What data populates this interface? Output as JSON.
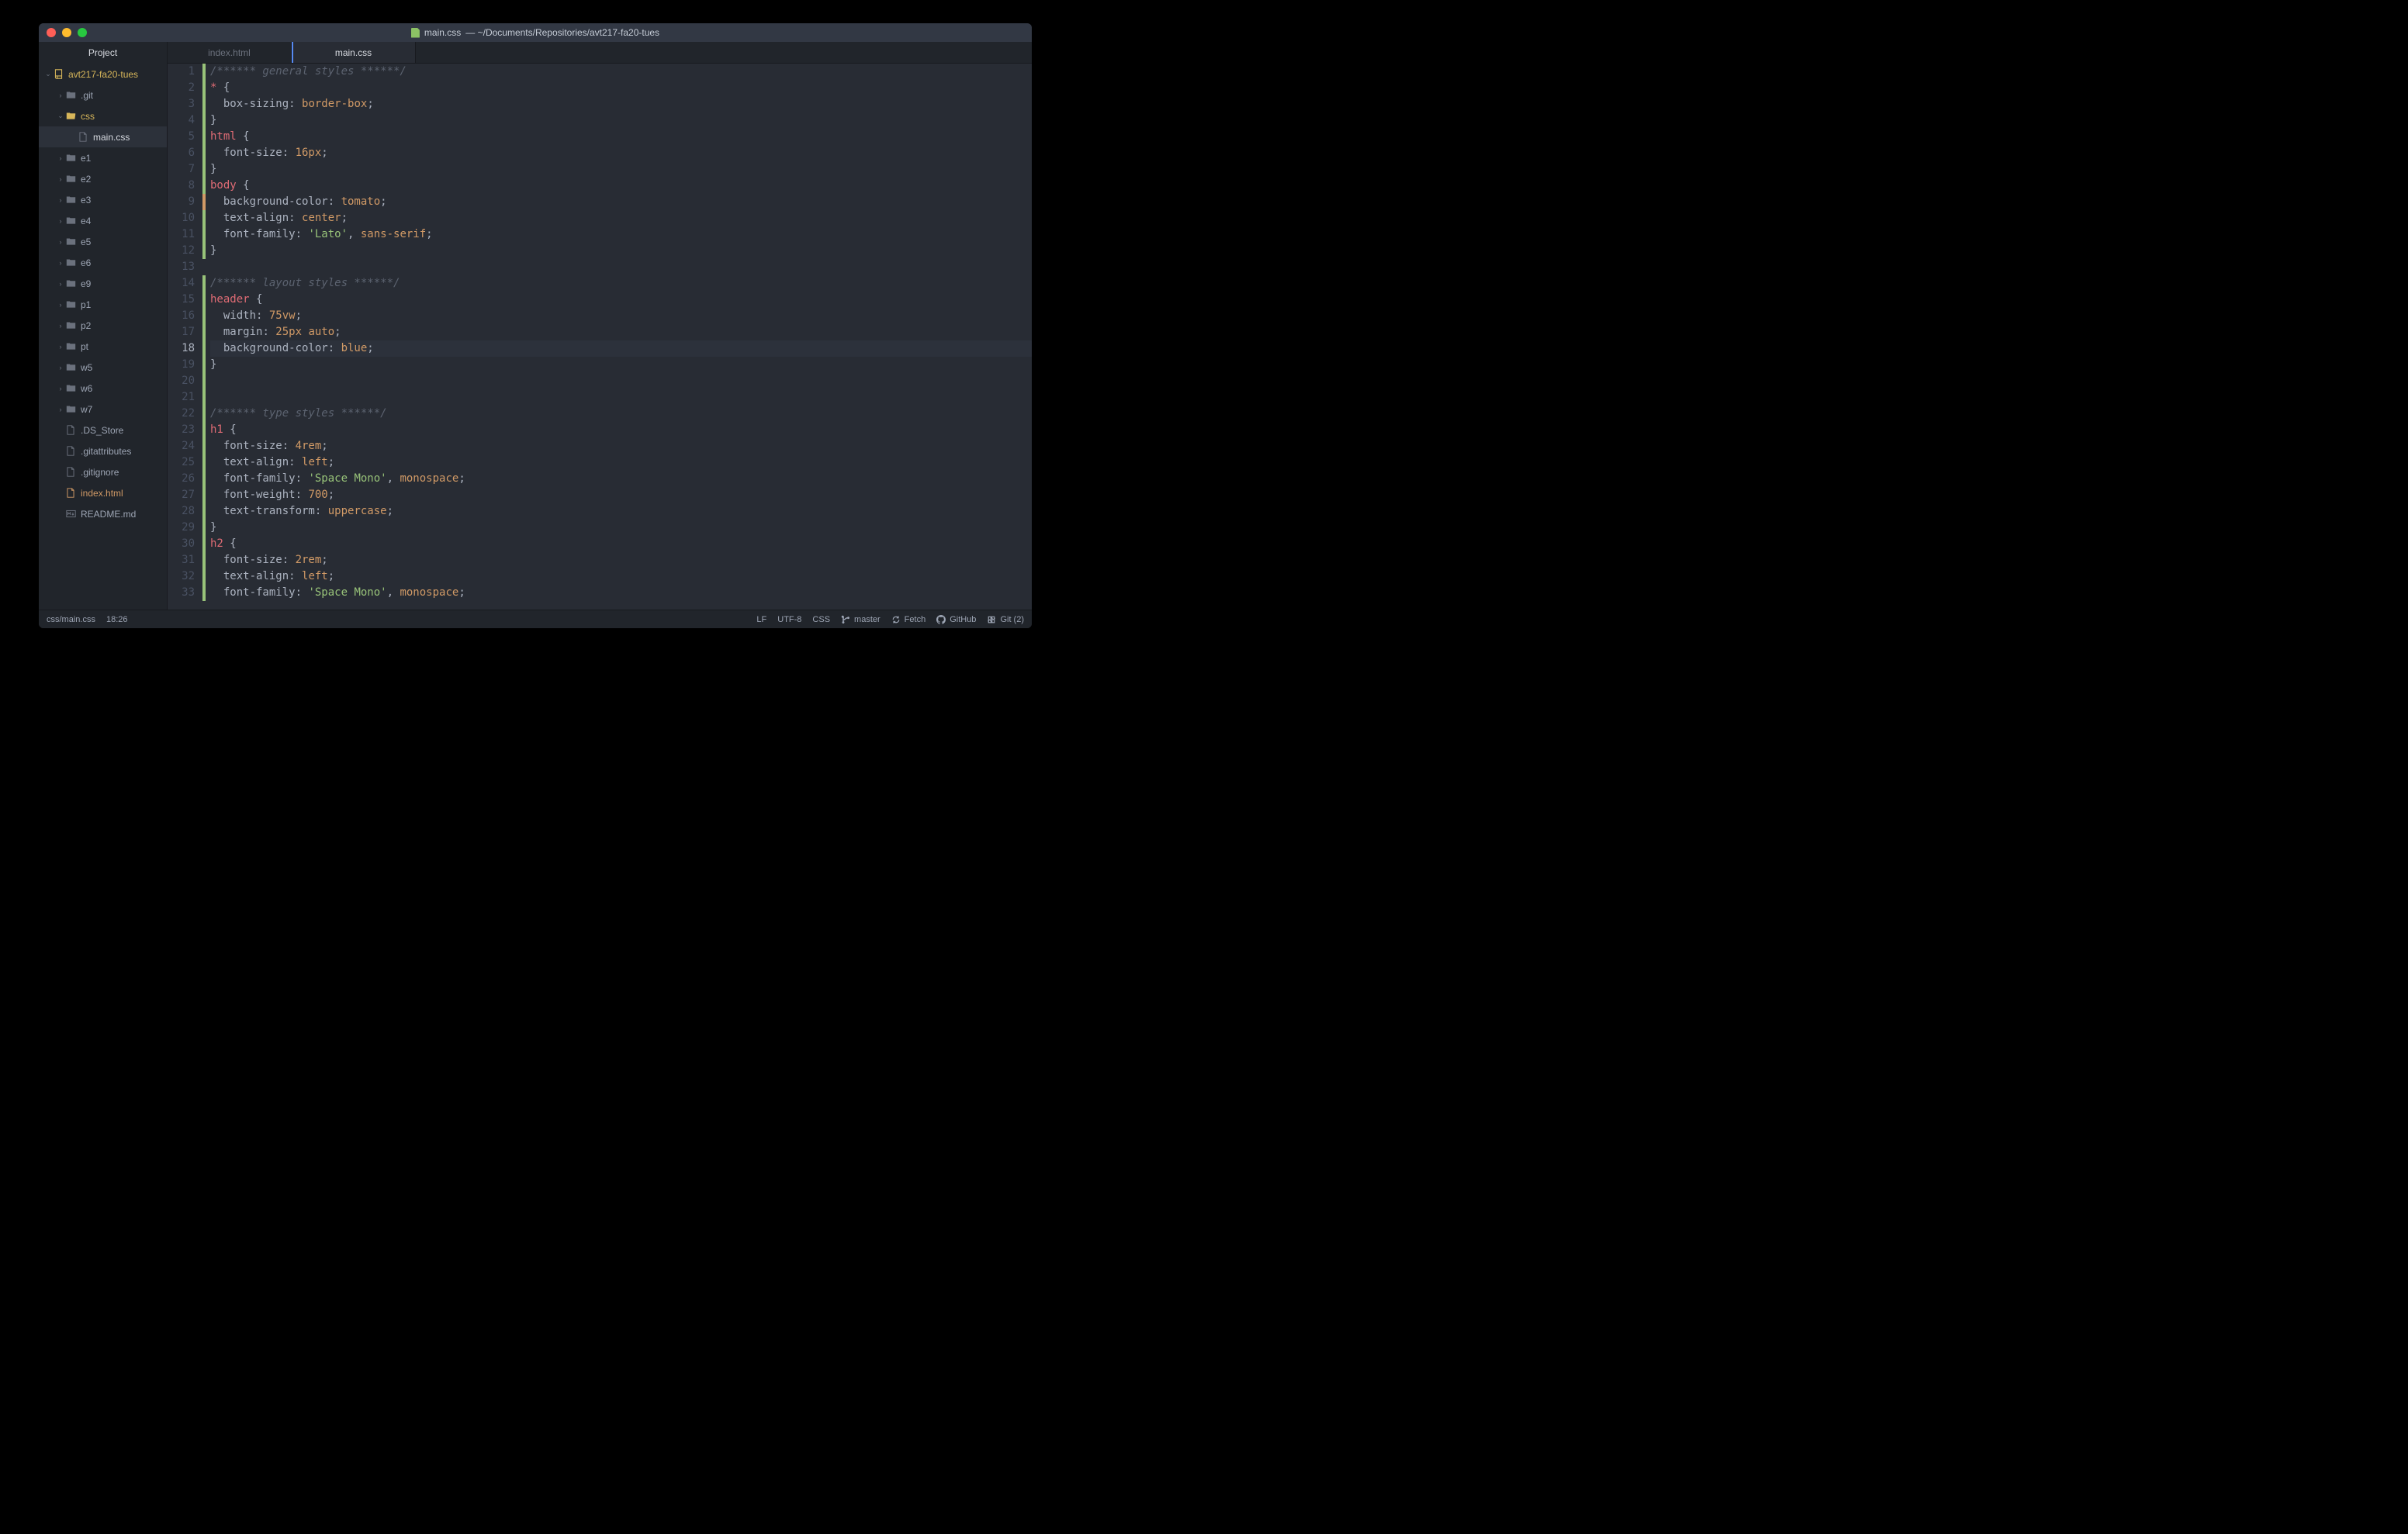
{
  "window": {
    "title_file": "main.css",
    "title_path": "— ~/Documents/Repositories/avt217-fa20-tues"
  },
  "sidebar": {
    "header": "Project",
    "root": "avt217-fa20-tues",
    "items": [
      {
        "label": ".git",
        "type": "folder",
        "depth": 1,
        "expanded": false
      },
      {
        "label": "css",
        "type": "folder",
        "depth": 1,
        "expanded": true
      },
      {
        "label": "main.css",
        "type": "file",
        "depth": 2,
        "selected": true
      },
      {
        "label": "e1",
        "type": "folder",
        "depth": 1,
        "expanded": false
      },
      {
        "label": "e2",
        "type": "folder",
        "depth": 1,
        "expanded": false
      },
      {
        "label": "e3",
        "type": "folder",
        "depth": 1,
        "expanded": false
      },
      {
        "label": "e4",
        "type": "folder",
        "depth": 1,
        "expanded": false
      },
      {
        "label": "e5",
        "type": "folder",
        "depth": 1,
        "expanded": false
      },
      {
        "label": "e6",
        "type": "folder",
        "depth": 1,
        "expanded": false
      },
      {
        "label": "e9",
        "type": "folder",
        "depth": 1,
        "expanded": false
      },
      {
        "label": "p1",
        "type": "folder",
        "depth": 1,
        "expanded": false
      },
      {
        "label": "p2",
        "type": "folder",
        "depth": 1,
        "expanded": false
      },
      {
        "label": "pt",
        "type": "folder",
        "depth": 1,
        "expanded": false
      },
      {
        "label": "w5",
        "type": "folder",
        "depth": 1,
        "expanded": false
      },
      {
        "label": "w6",
        "type": "folder",
        "depth": 1,
        "expanded": false
      },
      {
        "label": "w7",
        "type": "folder",
        "depth": 1,
        "expanded": false
      },
      {
        "label": ".DS_Store",
        "type": "file",
        "depth": 1
      },
      {
        "label": ".gitattributes",
        "type": "file",
        "depth": 1
      },
      {
        "label": ".gitignore",
        "type": "file",
        "depth": 1
      },
      {
        "label": "index.html",
        "type": "html",
        "depth": 1
      },
      {
        "label": "README.md",
        "type": "md",
        "depth": 1
      }
    ]
  },
  "tabs": [
    {
      "label": "index.html",
      "active": false
    },
    {
      "label": "main.css",
      "active": true
    }
  ],
  "code": {
    "cursor_line": 18,
    "lines": [
      {
        "n": 1,
        "diff": "green",
        "t": [
          {
            "c": "tok-comment",
            "s": "/****** general styles ******/"
          }
        ]
      },
      {
        "n": 2,
        "diff": "green",
        "t": [
          {
            "c": "tok-sel",
            "s": "*"
          },
          {
            "c": "tok-brace",
            "s": " {"
          }
        ]
      },
      {
        "n": 3,
        "diff": "green",
        "t": [
          {
            "c": "tok-prop",
            "s": "  box-sizing"
          },
          {
            "c": "tok-punc",
            "s": ": "
          },
          {
            "c": "tok-val",
            "s": "border-box"
          },
          {
            "c": "tok-punc",
            "s": ";"
          }
        ]
      },
      {
        "n": 4,
        "diff": "green",
        "t": [
          {
            "c": "tok-brace",
            "s": "}"
          }
        ]
      },
      {
        "n": 5,
        "diff": "green",
        "t": [
          {
            "c": "tok-sel",
            "s": "html"
          },
          {
            "c": "tok-brace",
            "s": " {"
          }
        ]
      },
      {
        "n": 6,
        "diff": "green",
        "t": [
          {
            "c": "tok-prop",
            "s": "  font-size"
          },
          {
            "c": "tok-punc",
            "s": ": "
          },
          {
            "c": "tok-val",
            "s": "16px"
          },
          {
            "c": "tok-punc",
            "s": ";"
          }
        ]
      },
      {
        "n": 7,
        "diff": "green",
        "t": [
          {
            "c": "tok-brace",
            "s": "}"
          }
        ]
      },
      {
        "n": 8,
        "diff": "green",
        "t": [
          {
            "c": "tok-sel",
            "s": "body"
          },
          {
            "c": "tok-brace",
            "s": " {"
          }
        ]
      },
      {
        "n": 9,
        "diff": "orange",
        "t": [
          {
            "c": "tok-prop",
            "s": "  background-color"
          },
          {
            "c": "tok-punc",
            "s": ": "
          },
          {
            "c": "tok-val",
            "s": "tomato"
          },
          {
            "c": "tok-punc",
            "s": ";"
          }
        ]
      },
      {
        "n": 10,
        "diff": "green",
        "t": [
          {
            "c": "tok-prop",
            "s": "  text-align"
          },
          {
            "c": "tok-punc",
            "s": ": "
          },
          {
            "c": "tok-val",
            "s": "center"
          },
          {
            "c": "tok-punc",
            "s": ";"
          }
        ]
      },
      {
        "n": 11,
        "diff": "green",
        "t": [
          {
            "c": "tok-prop",
            "s": "  font-family"
          },
          {
            "c": "tok-punc",
            "s": ": "
          },
          {
            "c": "tok-str",
            "s": "'Lato'"
          },
          {
            "c": "tok-punc",
            "s": ", "
          },
          {
            "c": "tok-val",
            "s": "sans-serif"
          },
          {
            "c": "tok-punc",
            "s": ";"
          }
        ]
      },
      {
        "n": 12,
        "diff": "green",
        "t": [
          {
            "c": "tok-brace",
            "s": "}"
          }
        ]
      },
      {
        "n": 13,
        "diff": "",
        "t": []
      },
      {
        "n": 14,
        "diff": "green",
        "t": [
          {
            "c": "tok-comment",
            "s": "/****** layout styles ******/"
          }
        ]
      },
      {
        "n": 15,
        "diff": "green",
        "t": [
          {
            "c": "tok-sel",
            "s": "header"
          },
          {
            "c": "tok-brace",
            "s": " {"
          }
        ]
      },
      {
        "n": 16,
        "diff": "green",
        "t": [
          {
            "c": "tok-prop",
            "s": "  width"
          },
          {
            "c": "tok-punc",
            "s": ": "
          },
          {
            "c": "tok-val",
            "s": "75vw"
          },
          {
            "c": "tok-punc",
            "s": ";"
          }
        ]
      },
      {
        "n": 17,
        "diff": "green",
        "t": [
          {
            "c": "tok-prop",
            "s": "  margin"
          },
          {
            "c": "tok-punc",
            "s": ": "
          },
          {
            "c": "tok-val",
            "s": "25px"
          },
          {
            "c": "tok-punc",
            "s": " "
          },
          {
            "c": "tok-val",
            "s": "auto"
          },
          {
            "c": "tok-punc",
            "s": ";"
          }
        ]
      },
      {
        "n": 18,
        "diff": "green",
        "cursor": true,
        "t": [
          {
            "c": "tok-prop",
            "s": "  background-color"
          },
          {
            "c": "tok-punc",
            "s": ": "
          },
          {
            "c": "tok-val",
            "s": "blue"
          },
          {
            "c": "tok-punc",
            "s": ";"
          }
        ]
      },
      {
        "n": 19,
        "diff": "green",
        "t": [
          {
            "c": "tok-brace",
            "s": "}"
          }
        ]
      },
      {
        "n": 20,
        "diff": "green",
        "t": []
      },
      {
        "n": 21,
        "diff": "green",
        "t": []
      },
      {
        "n": 22,
        "diff": "green",
        "t": [
          {
            "c": "tok-comment",
            "s": "/****** type styles ******/"
          }
        ]
      },
      {
        "n": 23,
        "diff": "green",
        "t": [
          {
            "c": "tok-sel",
            "s": "h1"
          },
          {
            "c": "tok-brace",
            "s": " {"
          }
        ]
      },
      {
        "n": 24,
        "diff": "green",
        "t": [
          {
            "c": "tok-prop",
            "s": "  font-size"
          },
          {
            "c": "tok-punc",
            "s": ": "
          },
          {
            "c": "tok-val",
            "s": "4rem"
          },
          {
            "c": "tok-punc",
            "s": ";"
          }
        ]
      },
      {
        "n": 25,
        "diff": "green",
        "t": [
          {
            "c": "tok-prop",
            "s": "  text-align"
          },
          {
            "c": "tok-punc",
            "s": ": "
          },
          {
            "c": "tok-val",
            "s": "left"
          },
          {
            "c": "tok-punc",
            "s": ";"
          }
        ]
      },
      {
        "n": 26,
        "diff": "green",
        "t": [
          {
            "c": "tok-prop",
            "s": "  font-family"
          },
          {
            "c": "tok-punc",
            "s": ": "
          },
          {
            "c": "tok-str",
            "s": "'Space Mono'"
          },
          {
            "c": "tok-punc",
            "s": ", "
          },
          {
            "c": "tok-val",
            "s": "monospace"
          },
          {
            "c": "tok-punc",
            "s": ";"
          }
        ]
      },
      {
        "n": 27,
        "diff": "green",
        "t": [
          {
            "c": "tok-prop",
            "s": "  font-weight"
          },
          {
            "c": "tok-punc",
            "s": ": "
          },
          {
            "c": "tok-val",
            "s": "700"
          },
          {
            "c": "tok-punc",
            "s": ";"
          }
        ]
      },
      {
        "n": 28,
        "diff": "green",
        "t": [
          {
            "c": "tok-prop",
            "s": "  text-transform"
          },
          {
            "c": "tok-punc",
            "s": ": "
          },
          {
            "c": "tok-val",
            "s": "uppercase"
          },
          {
            "c": "tok-punc",
            "s": ";"
          }
        ]
      },
      {
        "n": 29,
        "diff": "green",
        "t": [
          {
            "c": "tok-brace",
            "s": "}"
          }
        ]
      },
      {
        "n": 30,
        "diff": "green",
        "t": [
          {
            "c": "tok-sel",
            "s": "h2"
          },
          {
            "c": "tok-brace",
            "s": " {"
          }
        ]
      },
      {
        "n": 31,
        "diff": "green",
        "t": [
          {
            "c": "tok-prop",
            "s": "  font-size"
          },
          {
            "c": "tok-punc",
            "s": ": "
          },
          {
            "c": "tok-val",
            "s": "2rem"
          },
          {
            "c": "tok-punc",
            "s": ";"
          }
        ]
      },
      {
        "n": 32,
        "diff": "green",
        "t": [
          {
            "c": "tok-prop",
            "s": "  text-align"
          },
          {
            "c": "tok-punc",
            "s": ": "
          },
          {
            "c": "tok-val",
            "s": "left"
          },
          {
            "c": "tok-punc",
            "s": ";"
          }
        ]
      },
      {
        "n": 33,
        "diff": "green",
        "t": [
          {
            "c": "tok-prop",
            "s": "  font-family"
          },
          {
            "c": "tok-punc",
            "s": ": "
          },
          {
            "c": "tok-str",
            "s": "'Space Mono'"
          },
          {
            "c": "tok-punc",
            "s": ", "
          },
          {
            "c": "tok-val",
            "s": "monospace"
          },
          {
            "c": "tok-punc",
            "s": ";"
          }
        ]
      }
    ]
  },
  "statusbar": {
    "path": "css/main.css",
    "cursor": "18:26",
    "eol": "LF",
    "encoding": "UTF-8",
    "lang": "CSS",
    "branch": "master",
    "fetch": "Fetch",
    "github": "GitHub",
    "git": "Git (2)"
  }
}
